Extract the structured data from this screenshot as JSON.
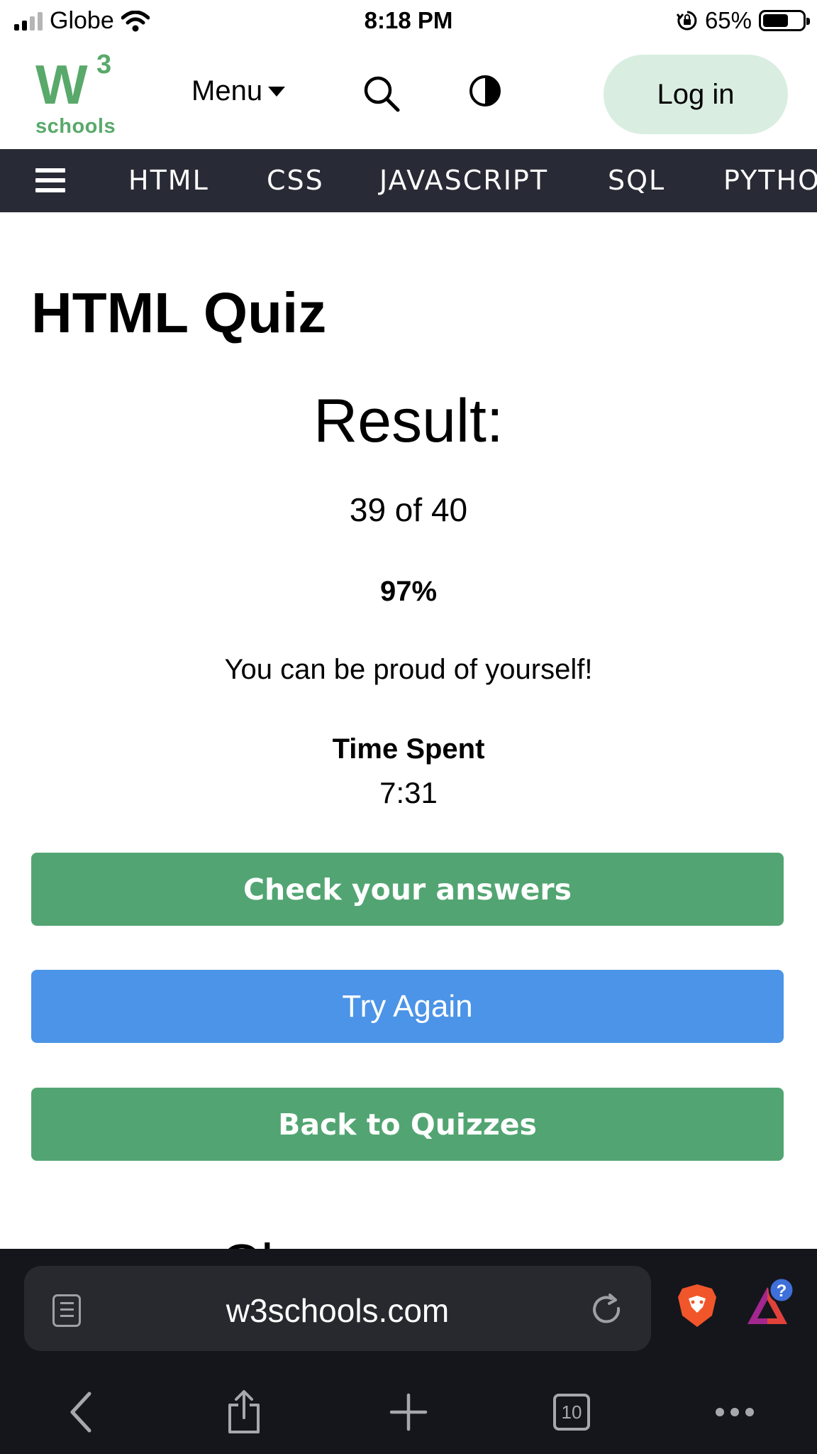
{
  "status_bar": {
    "carrier": "Globe",
    "time": "8:18 PM",
    "battery": "65%",
    "battery_level": 0.65
  },
  "header": {
    "logo_mark": "W",
    "logo_superscript": "3",
    "logo_text": "schools",
    "menu_label": "Menu",
    "login_label": "Log in",
    "brand_color": "#59a96a"
  },
  "topic_nav": {
    "items": [
      "HTML",
      "CSS",
      "JAVASCRIPT",
      "SQL",
      "PYTHO"
    ]
  },
  "main": {
    "page_title": "HTML Quiz",
    "result_heading": "Result:",
    "score": "39 of 40",
    "percent": "97%",
    "message": "You can be proud of yourself!",
    "time_label": "Time Spent",
    "time_value": "7:31",
    "check_answers_label": "Check your answers",
    "try_again_label": "Try Again",
    "back_label": "Back to Quizzes",
    "partial_heading": "Ch"
  },
  "browser": {
    "url": "w3schools.com",
    "tab_count": "10",
    "rewards_badge": "?"
  },
  "colors": {
    "green_button": "#52a572",
    "blue_button": "#4b94e7",
    "nav_background": "#282a35",
    "login_background": "#d9eee1",
    "browser_background": "#15161c"
  }
}
